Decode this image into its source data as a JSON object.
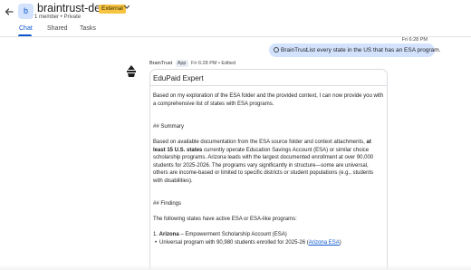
{
  "header": {
    "back_icon": "arrow-left-icon",
    "avatar_letter": "b",
    "title": "braintrust-demo",
    "badge": "External",
    "subtitle": "1 member • Private",
    "dropdown_icon": "chevron-down-icon"
  },
  "tabs": [
    {
      "label": "Chat",
      "active": true
    },
    {
      "label": "Shared",
      "active": false
    },
    {
      "label": "Tasks",
      "active": false
    }
  ],
  "outgoing": {
    "time": "Fri 6:28 PM",
    "mention": "BrainTrust",
    "text": "List every state in the US that has an ESA program."
  },
  "bot": {
    "name": "BrainTrust",
    "app_tag": "App",
    "meta": "Fri 6:28 PM • Edited",
    "card_title": "EduPaid Expert",
    "intro": "Based on my exploration of the ESA folder and the provided context, I can now provide you with a comprehensive list of states with ESA programs.",
    "summary_heading": "## Summary",
    "summary_pre": "Based on available documentation from the ESA source folder and context attachments, ",
    "summary_bold": "at least 15 U.S. states",
    "summary_post": " currently operate Education Savings Account (ESA) or similar choice scholarship programs. Arizona leads with the largest documented enrollment at over 90,000 students for 2025-2026. The programs vary significantly in structure—some are universal, others are income-based or limited to specific districts or student populations (e.g., students with disabilities).",
    "findings_heading": "## Findings",
    "findings_intro": "The following states have active ESA or ESA-like programs:",
    "item1_num": "1. ",
    "item1_state": "Arizona",
    "item1_rest": " – Empowerment Scholarship Account (ESA)",
    "item1_bullet_pre": "Universal program with 90,980 students enrolled for 2025-26 (",
    "item1_bullet_link": "Arizona ESA",
    "item1_bullet_post": ")"
  },
  "colors": {
    "accent": "#0b57d0",
    "badge_bg": "#f6c441",
    "bubble_bg": "#d3e3fd"
  }
}
